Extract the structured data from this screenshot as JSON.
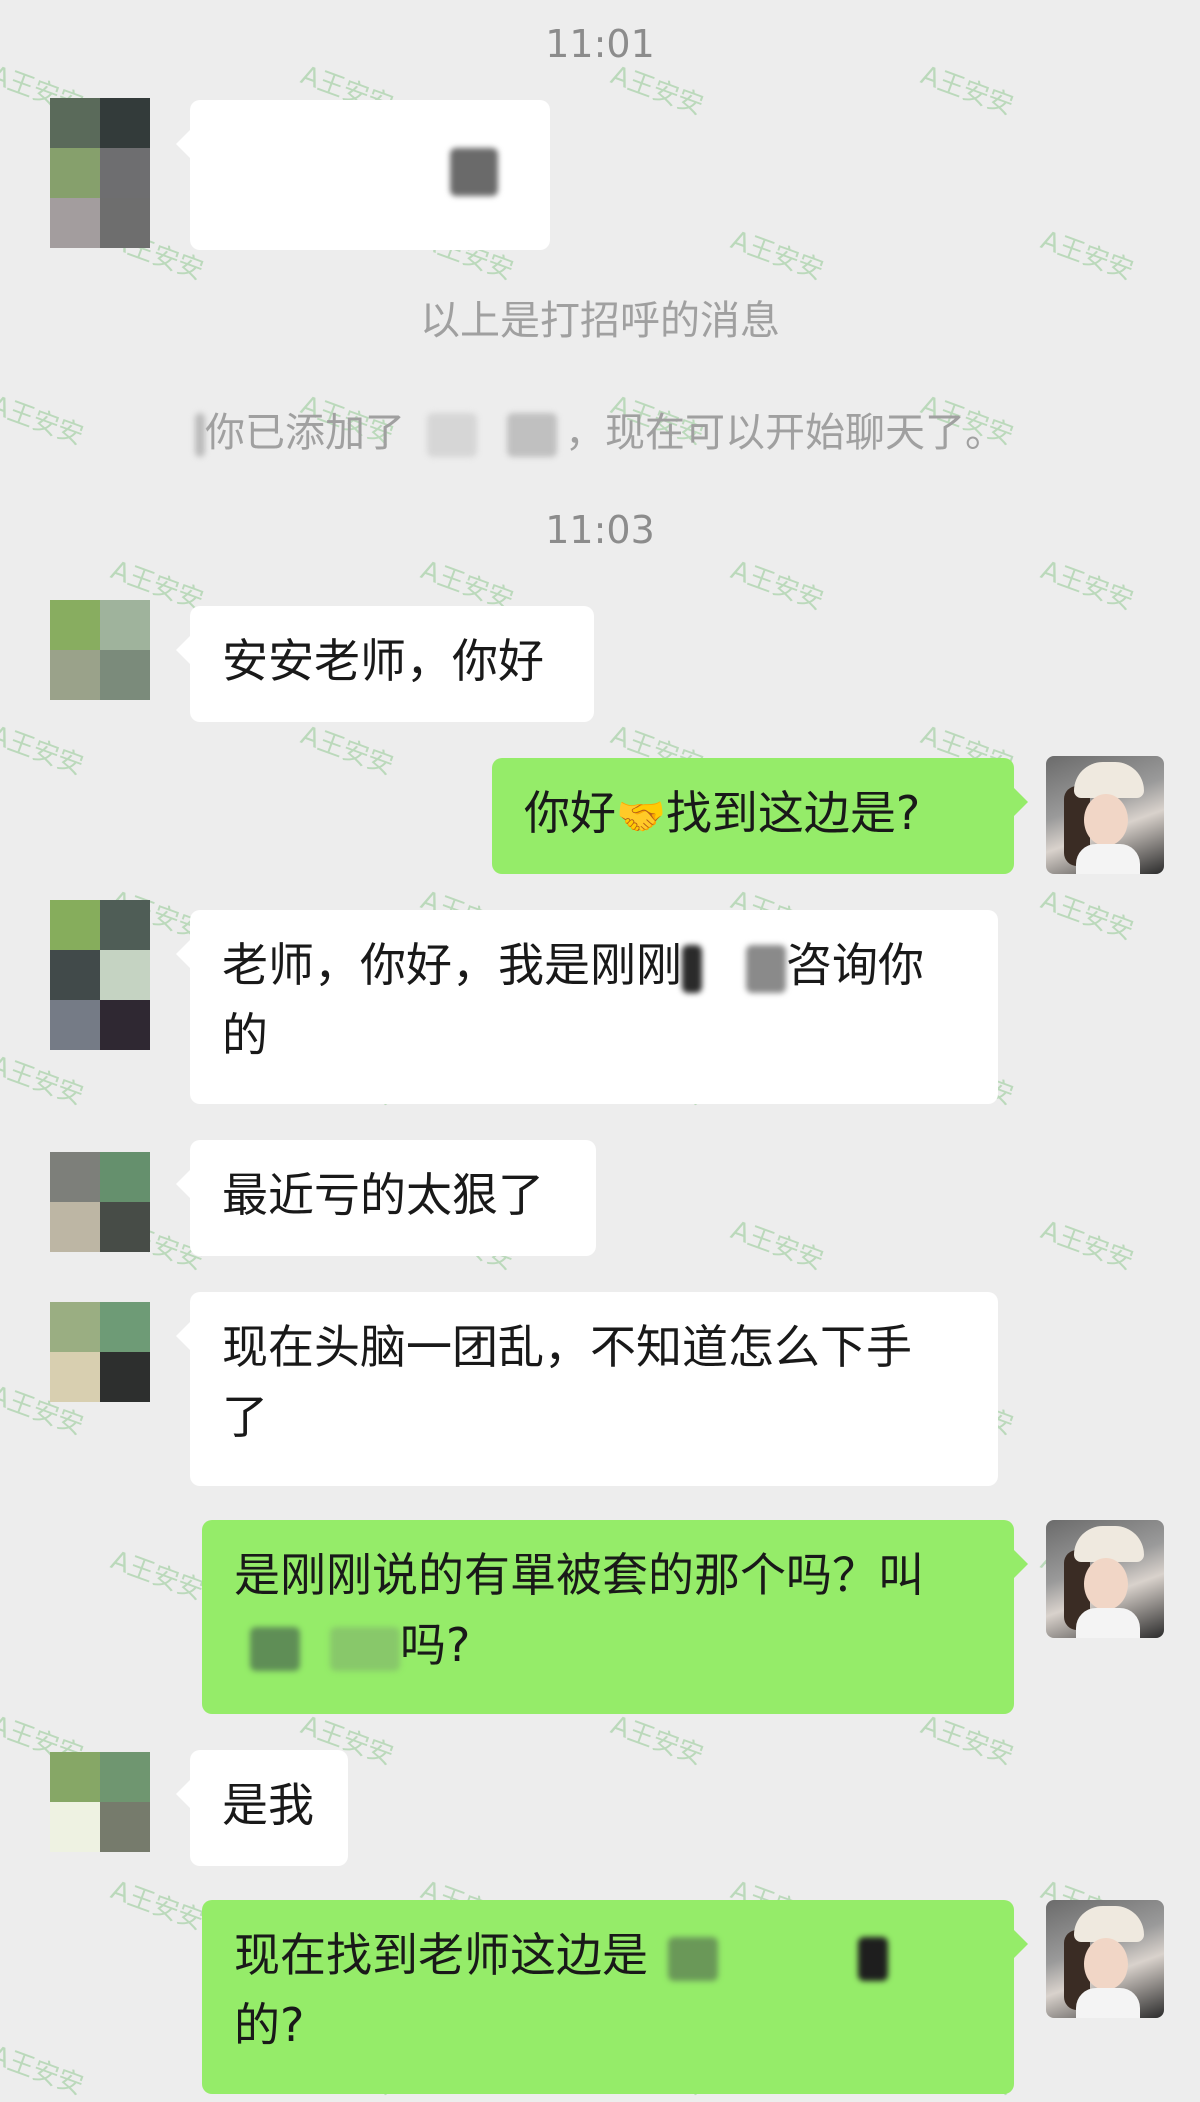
{
  "time_1": "11:01",
  "time_2": "11:03",
  "system": {
    "greeting_notice": "以上是打招呼的消息",
    "added_prefix": "你已添加了",
    "added_sep": "，",
    "added_suffix": "现在可以开始聊天了。"
  },
  "messages": [
    {
      "text": "安安老师，你好"
    },
    {
      "text_a": "你好",
      "emoji": "🤝",
      "text_b": "找到这边是?"
    },
    {
      "text_a": "老师，你好，我是刚刚",
      "text_b": "咨询你",
      "text_c": "的"
    },
    {
      "text": "最近亏的太狠了"
    },
    {
      "text_a": "现在头脑一团乱，不知道怎么下手",
      "text_b": "了"
    },
    {
      "text_a": "是刚刚说的有單被套的那个吗？叫",
      "text_b": "吗?"
    },
    {
      "text": "是我"
    },
    {
      "text_a": "现在找到老师这边是",
      "text_b": "的?"
    }
  ],
  "watermark_text": "A王安安",
  "colors": {
    "background": "#ededed",
    "incoming_bubble": "#ffffff",
    "outgoing_bubble": "#95ec69"
  }
}
